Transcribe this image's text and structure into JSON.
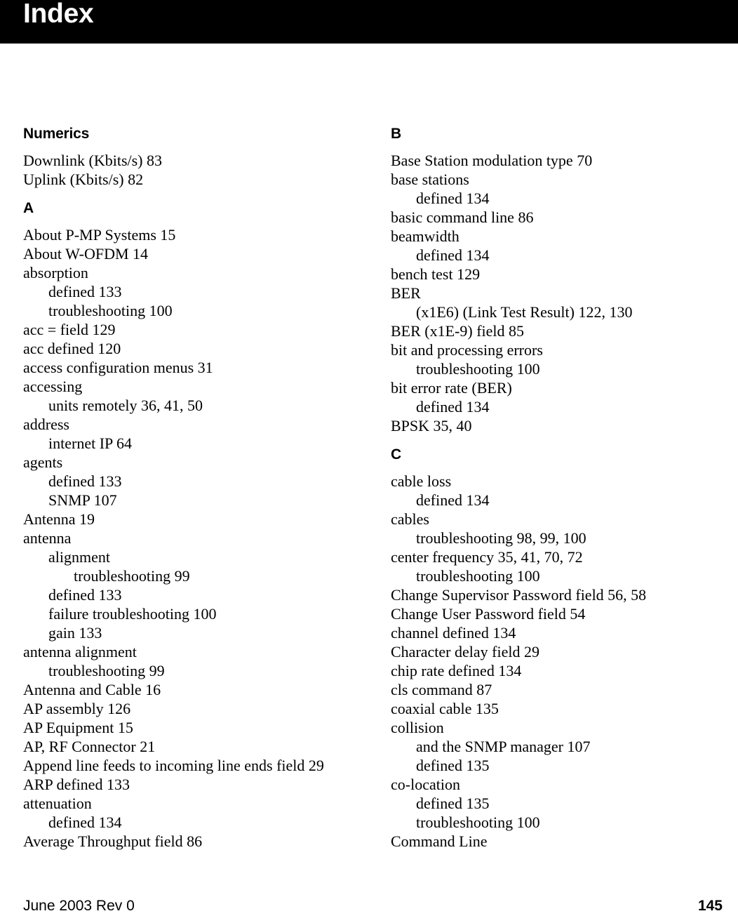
{
  "header": {
    "title": "Index",
    "background_color": "#000000",
    "text_color": "#ffffff"
  },
  "footer": {
    "left_text": "June 2003 Rev 0",
    "page_number": "145"
  },
  "columns": [
    {
      "name": "left-column",
      "sections": [
        {
          "heading": "Numerics",
          "entries": [
            {
              "text": "Downlink (Kbits/s) 83",
              "level": 0
            },
            {
              "text": "Uplink (Kbits/s) 82",
              "level": 0
            }
          ]
        },
        {
          "heading": "A",
          "entries": [
            {
              "text": "About P-MP Systems 15",
              "level": 0
            },
            {
              "text": "About W-OFDM 14",
              "level": 0
            },
            {
              "text": "absorption",
              "level": 0
            },
            {
              "text": "defined 133",
              "level": 1
            },
            {
              "text": "troubleshooting 100",
              "level": 1
            },
            {
              "text": "acc = field 129",
              "level": 0
            },
            {
              "text": "acc defined 120",
              "level": 0
            },
            {
              "text": "access configuration menus 31",
              "level": 0
            },
            {
              "text": "accessing",
              "level": 0
            },
            {
              "text": "units remotely 36, 41, 50",
              "level": 1
            },
            {
              "text": "address",
              "level": 0
            },
            {
              "text": "internet IP 64",
              "level": 1
            },
            {
              "text": "agents",
              "level": 0
            },
            {
              "text": "defined 133",
              "level": 1
            },
            {
              "text": "SNMP 107",
              "level": 1
            },
            {
              "text": "Antenna 19",
              "level": 0
            },
            {
              "text": "antenna",
              "level": 0
            },
            {
              "text": "alignment",
              "level": 1
            },
            {
              "text": "troubleshooting 99",
              "level": 2
            },
            {
              "text": "defined 133",
              "level": 1
            },
            {
              "text": "failure troubleshooting 100",
              "level": 1
            },
            {
              "text": "gain 133",
              "level": 1
            },
            {
              "text": "antenna alignment",
              "level": 0
            },
            {
              "text": "troubleshooting 99",
              "level": 1
            },
            {
              "text": "Antenna and Cable 16",
              "level": 0
            },
            {
              "text": "AP assembly 126",
              "level": 0
            },
            {
              "text": "AP Equipment 15",
              "level": 0
            },
            {
              "text": "AP, RF Connector 21",
              "level": 0
            },
            {
              "text": "Append line feeds to incoming line ends field 29",
              "level": 0
            },
            {
              "text": "ARP defined 133",
              "level": 0
            },
            {
              "text": "attenuation",
              "level": 0
            },
            {
              "text": "defined 134",
              "level": 1
            },
            {
              "text": "Average Throughput field 86",
              "level": 0
            }
          ]
        }
      ]
    },
    {
      "name": "right-column",
      "sections": [
        {
          "heading": "B",
          "entries": [
            {
              "text": "Base Station modulation type 70",
              "level": 0
            },
            {
              "text": "base stations",
              "level": 0
            },
            {
              "text": "defined 134",
              "level": 1
            },
            {
              "text": "basic command line 86",
              "level": 0
            },
            {
              "text": "beamwidth",
              "level": 0
            },
            {
              "text": "defined 134",
              "level": 1
            },
            {
              "text": "bench test 129",
              "level": 0
            },
            {
              "text": "BER",
              "level": 0
            },
            {
              "text": "(x1E6) (Link Test Result) 122, 130",
              "level": 1
            },
            {
              "text": "BER (x1E-9) field 85",
              "level": 0
            },
            {
              "text": "bit and processing errors",
              "level": 0
            },
            {
              "text": "troubleshooting 100",
              "level": 1
            },
            {
              "text": "bit error rate (BER)",
              "level": 0
            },
            {
              "text": "defined 134",
              "level": 1
            },
            {
              "text": "BPSK 35, 40",
              "level": 0
            }
          ]
        },
        {
          "heading": "C",
          "entries": [
            {
              "text": "cable loss",
              "level": 0
            },
            {
              "text": "defined 134",
              "level": 1
            },
            {
              "text": "cables",
              "level": 0
            },
            {
              "text": "troubleshooting 98, 99, 100",
              "level": 1
            },
            {
              "text": "center frequency 35, 41, 70, 72",
              "level": 0
            },
            {
              "text": "troubleshooting 100",
              "level": 1
            },
            {
              "text": "Change Supervisor Password field 56, 58",
              "level": 0
            },
            {
              "text": "Change User Password field 54",
              "level": 0
            },
            {
              "text": "channel defined 134",
              "level": 0
            },
            {
              "text": "Character delay field 29",
              "level": 0
            },
            {
              "text": "chip rate defined 134",
              "level": 0
            },
            {
              "text": "cls command 87",
              "level": 0
            },
            {
              "text": "coaxial cable 135",
              "level": 0
            },
            {
              "text": "collision",
              "level": 0
            },
            {
              "text": "and the SNMP manager 107",
              "level": 1
            },
            {
              "text": "defined 135",
              "level": 1
            },
            {
              "text": "co-location",
              "level": 0
            },
            {
              "text": "defined 135",
              "level": 1
            },
            {
              "text": "troubleshooting 100",
              "level": 1
            },
            {
              "text": "Command Line",
              "level": 0
            }
          ]
        }
      ]
    }
  ]
}
